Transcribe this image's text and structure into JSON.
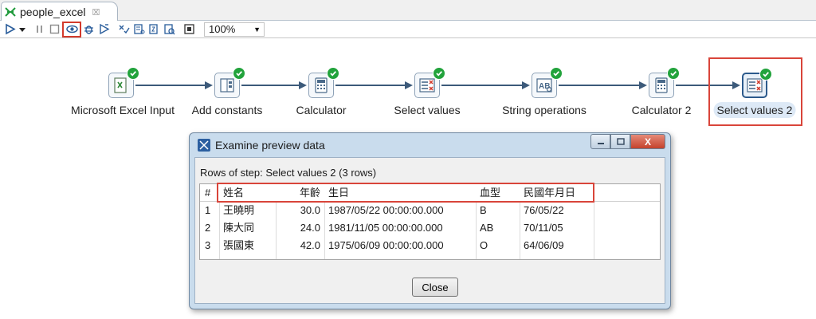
{
  "tab": {
    "title": "people_excel",
    "close_glyph": "☒"
  },
  "toolbar": {
    "zoom": "100%",
    "icons": [
      "run-icon",
      "dropdown-icon",
      "pause-icon",
      "stop-icon",
      "preview-icon",
      "debug-icon",
      "replay-icon",
      "verify-icon",
      "impact-icon",
      "sql-icon",
      "explore-db-icon",
      "align-icon"
    ]
  },
  "steps": [
    {
      "label": "Microsoft Excel Input",
      "icon": "excel-icon"
    },
    {
      "label": "Add constants",
      "icon": "constants-icon"
    },
    {
      "label": "Calculator",
      "icon": "calculator-icon"
    },
    {
      "label": "Select values",
      "icon": "select-values-icon"
    },
    {
      "label": "String operations",
      "icon": "string-operations-icon"
    },
    {
      "label": "Calculator 2",
      "icon": "calculator-icon"
    },
    {
      "label": "Select values 2",
      "icon": "select-values-icon"
    }
  ],
  "dialog": {
    "title": "Examine preview data",
    "rows_label": "Rows of step: Select values 2 (3 rows)",
    "columns": [
      "#",
      "姓名",
      "年齡",
      "生日",
      "血型",
      "民國年月日"
    ],
    "rows": [
      [
        "1",
        "王曉明",
        "30.0",
        "1987/05/22 00:00:00.000",
        "B",
        "76/05/22"
      ],
      [
        "2",
        "陳大同",
        "24.0",
        "1981/11/05 00:00:00.000",
        "AB",
        "70/11/05"
      ],
      [
        "3",
        "張國東",
        "42.0",
        "1975/06/09 00:00:00.000",
        "O",
        "64/06/09"
      ]
    ],
    "close_label": "Close",
    "window_close_glyph": "X"
  },
  "colors": {
    "highlight": "#d9453a",
    "ok": "#22a33c",
    "hop": "#3c5a7a"
  }
}
